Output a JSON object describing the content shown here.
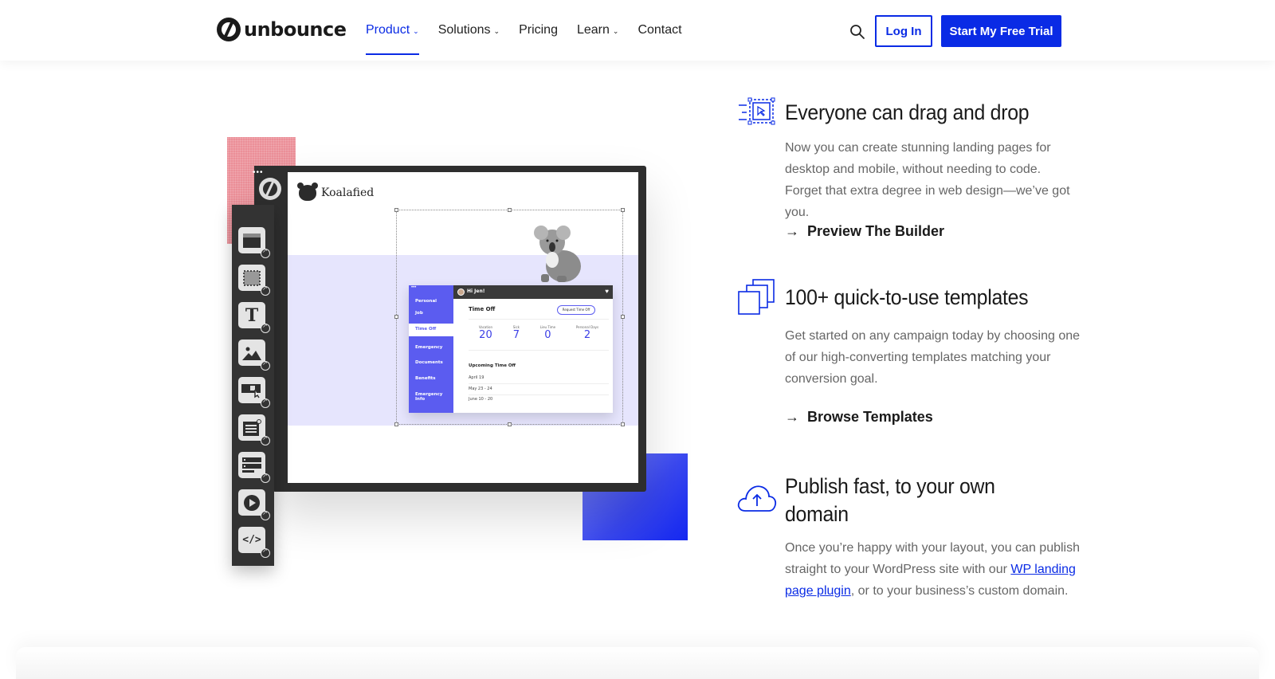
{
  "nav": {
    "brand": "unbounce",
    "items": [
      {
        "label": "Product",
        "has_dropdown": true,
        "active": true
      },
      {
        "label": "Solutions",
        "has_dropdown": true,
        "active": false
      },
      {
        "label": "Pricing",
        "has_dropdown": false,
        "active": false
      },
      {
        "label": "Learn",
        "has_dropdown": true,
        "active": false
      },
      {
        "label": "Contact",
        "has_dropdown": false,
        "active": false
      }
    ],
    "chevron": "⌄",
    "search_icon": "search-icon",
    "login_label": "Log In",
    "trial_label": "Start My Free Trial",
    "accent_color": "#0a2be5"
  },
  "illustration": {
    "menu_dots": "•••",
    "brand_name": "Koalafied",
    "app": {
      "side_dots": "•••",
      "side_items": [
        "Personal",
        "Job",
        "Time Off",
        "Emergency",
        "Documents",
        "Benefits",
        "Emergency Info"
      ],
      "active_item": "Time Off",
      "greeting": "Hi Jen!",
      "heart": "♥",
      "title": "Time Off",
      "request_button": "Request Time Off",
      "stats": [
        {
          "label": "Vacation",
          "value": "20"
        },
        {
          "label": "Sick",
          "value": "7"
        },
        {
          "label": "Lieu Time",
          "value": "0"
        },
        {
          "label": "Personal Days",
          "value": "2"
        }
      ],
      "upcoming_title": "Upcoming Time Off",
      "upcoming": [
        "April 19",
        "May 23 - 24",
        "June 10 - 20"
      ]
    },
    "tools": [
      "section-tool-icon",
      "box-tool-icon",
      "text-tool-icon",
      "image-tool-icon",
      "button-tool-icon",
      "form-tool-icon",
      "list-tool-icon",
      "video-tool-icon",
      "code-tool-icon"
    ],
    "text_tool_glyph": "T",
    "code_tool_glyph": "</>"
  },
  "features": [
    {
      "icon": "drag-drop-icon",
      "title": "Everyone can drag and drop",
      "description": "Now you can create stunning landing pages for desktop and mobile, without needing to code. Forget that extra degree in web design—we’ve got you.",
      "link_label": "Preview The Builder",
      "arrow": "→"
    },
    {
      "icon": "templates-icon",
      "title": "100+ quick-to-use templates",
      "description": "Get started on any campaign today by choosing one of our high-converting templates matching your conversion goal.",
      "link_label": "Browse Templates",
      "arrow": "→"
    },
    {
      "icon": "cloud-upload-icon",
      "title_line1": "Publish fast, to your own",
      "title_line2": "domain",
      "description_pre": "Once you’re happy with your layout, you can publish straight to your WordPress site with our ",
      "description_link": "WP landing page plugin",
      "description_post": ", or to your business’s custom domain."
    }
  ]
}
